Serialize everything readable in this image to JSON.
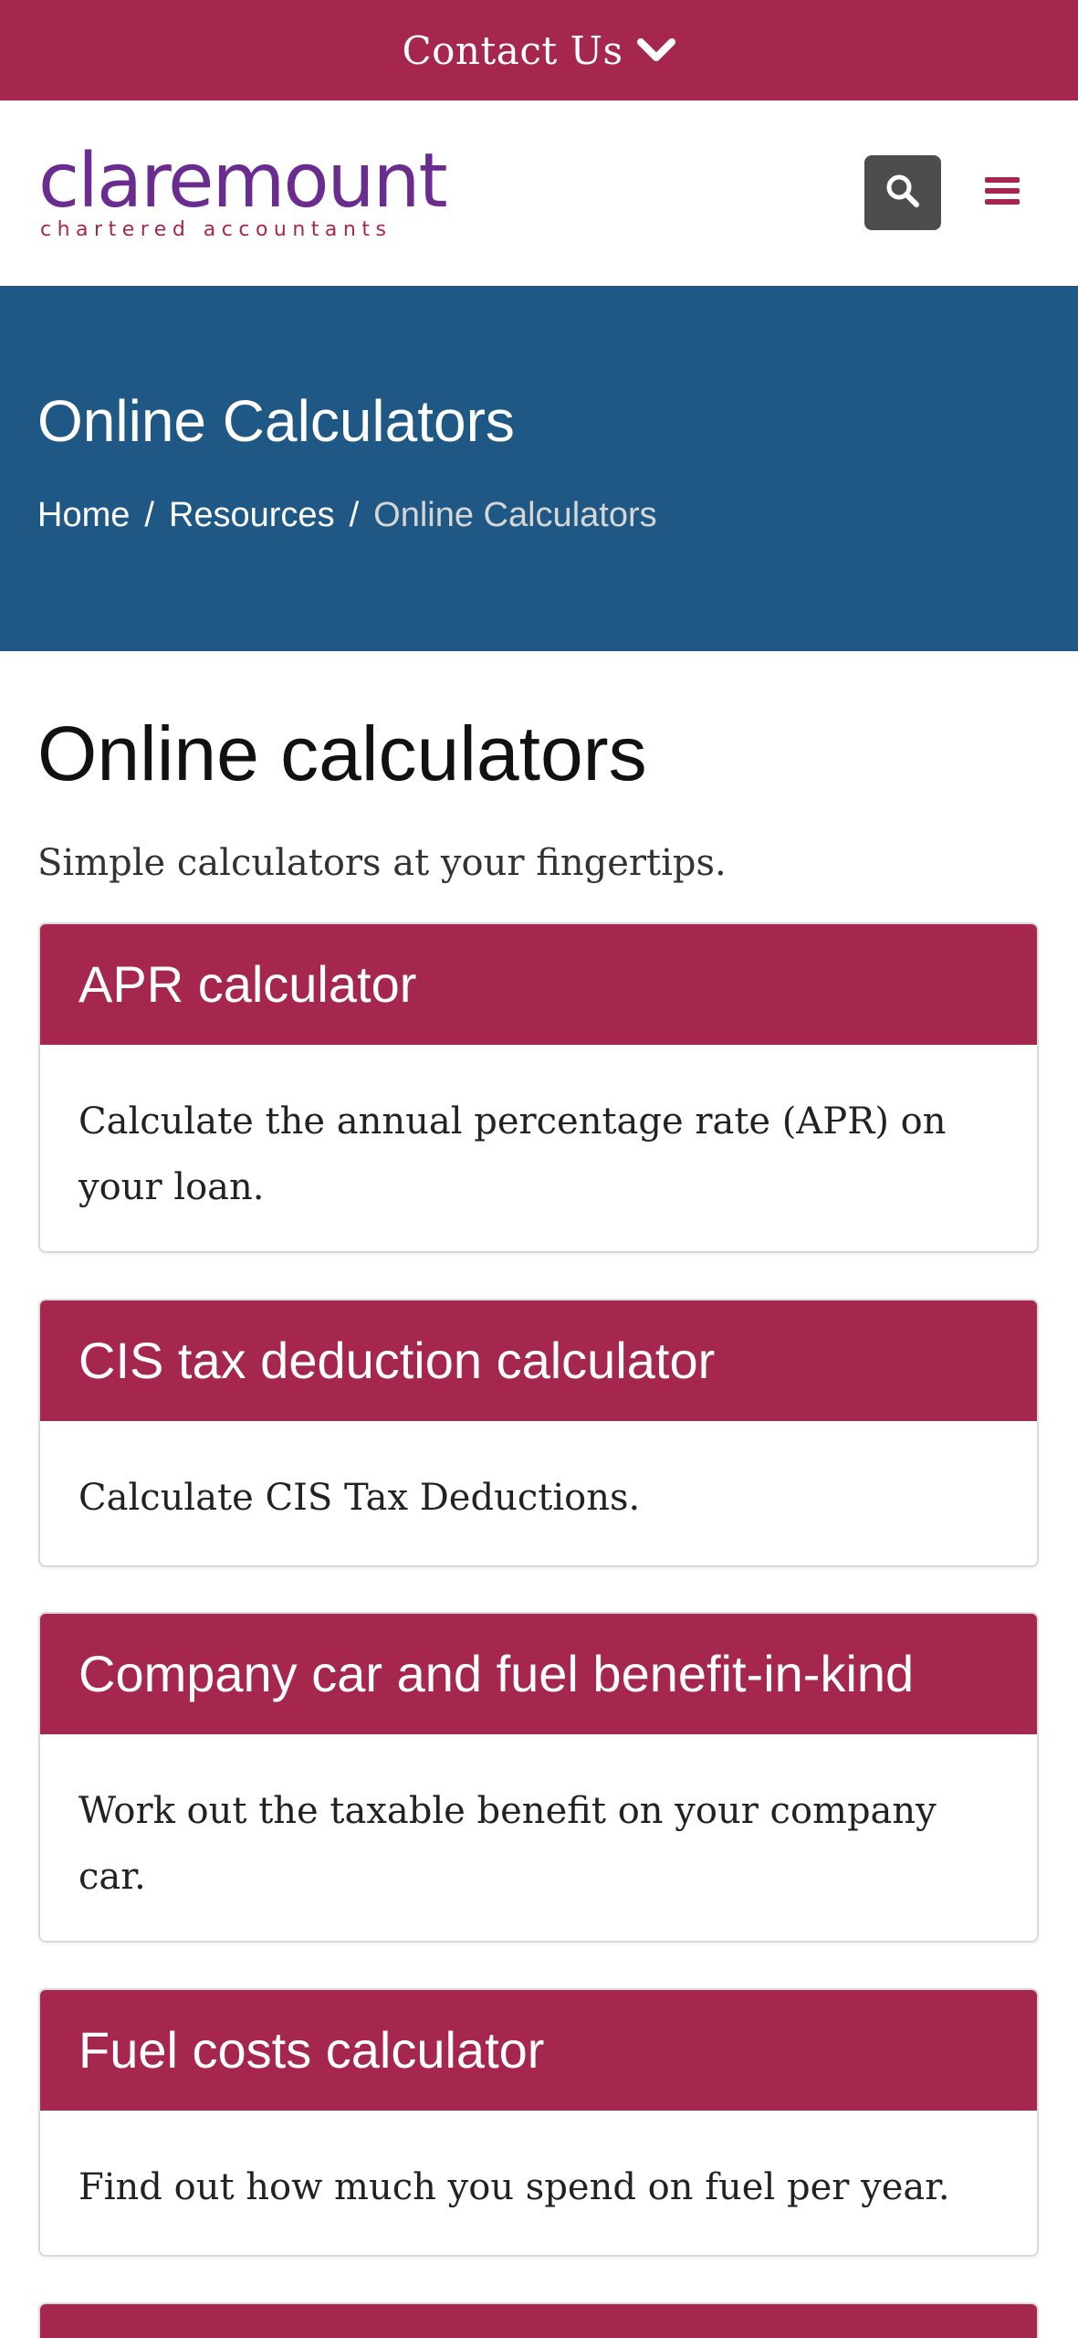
{
  "contact": {
    "label": "Contact Us"
  },
  "header": {
    "logo_main": "claremount",
    "logo_sub": "chartered accountants"
  },
  "hero": {
    "title": "Online Calculators",
    "breadcrumb": [
      "Home",
      "Resources",
      "Online Calculators"
    ]
  },
  "main": {
    "title": "Online calculators",
    "intro": "Simple calculators at your fingertips.",
    "cards": [
      {
        "title": "APR calculator",
        "description": "Calculate the annual percentage rate (APR) on your loan."
      },
      {
        "title": "CIS tax deduction calculator",
        "description": "Calculate CIS Tax Deductions."
      },
      {
        "title": "Company car and fuel benefit-in-kind",
        "description": "Work out the taxable benefit on your company car."
      },
      {
        "title": "Fuel costs calculator",
        "description": "Find out how much you spend on fuel per year."
      }
    ]
  },
  "colors": {
    "brand_maroon": "#a6274e",
    "brand_purple": "#6b2c8f",
    "hero_blue": "#1f5884",
    "search_grey": "#4d4d4d"
  }
}
